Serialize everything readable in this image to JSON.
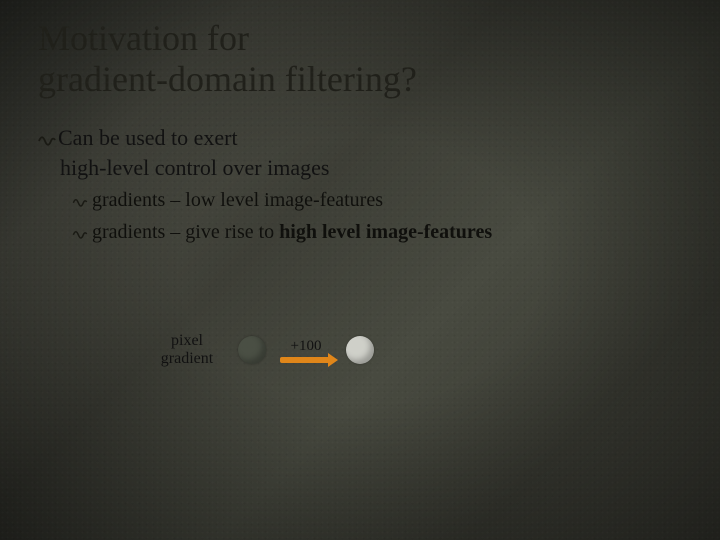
{
  "title_line1": "Motivation for",
  "title_line2": "gradient-domain filtering?",
  "bullets": {
    "b1_line1": "Can be used to exert",
    "b1_line2": "high-level control over images",
    "b1_sub1": "gradients – low level image-features",
    "b1_sub2_pre": "gradients – give rise to ",
    "b1_sub2_strong": "high level image-features"
  },
  "diagram": {
    "label_line1": "pixel",
    "label_line2": "gradient",
    "arrow_value": "+100"
  }
}
